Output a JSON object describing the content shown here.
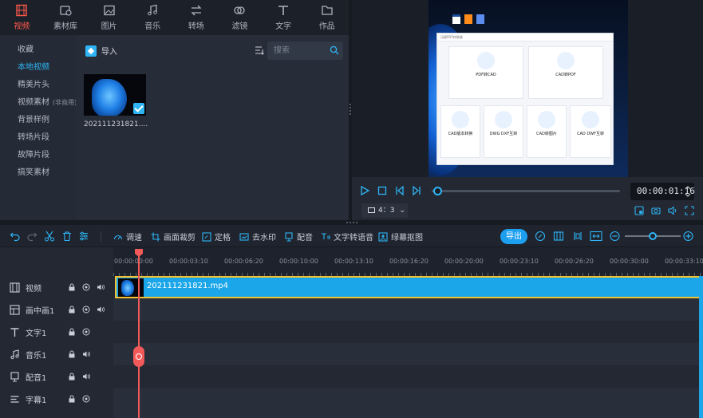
{
  "categories": [
    {
      "label": "视频",
      "icon": "film-icon",
      "active": true
    },
    {
      "label": "素材库",
      "icon": "media-library-icon"
    },
    {
      "label": "图片",
      "icon": "image-icon"
    },
    {
      "label": "音乐",
      "icon": "music-icon"
    },
    {
      "label": "转场",
      "icon": "transition-icon"
    },
    {
      "label": "滤镜",
      "icon": "filter-icon"
    },
    {
      "label": "文字",
      "icon": "text-icon"
    },
    {
      "label": "作品",
      "icon": "folder-icon"
    }
  ],
  "sidebar": {
    "items": [
      {
        "label": "收藏"
      },
      {
        "label": "本地视频",
        "active": true
      },
      {
        "label": "精美片头"
      },
      {
        "label": "视频素材",
        "sub": "(非商用)"
      },
      {
        "label": "背景样例"
      },
      {
        "label": "转场片段"
      },
      {
        "label": "故障片段"
      },
      {
        "label": "搞笑素材"
      }
    ]
  },
  "library": {
    "import_label": "导入",
    "search_placeholder": "搜索",
    "media": [
      {
        "name": "202111231821....",
        "selected": true
      }
    ]
  },
  "preview": {
    "window_title": "迅捷PDF转换器",
    "cards_row1": [
      {
        "title": "PDF转CAD"
      },
      {
        "title": "CAD转PDF"
      }
    ],
    "cards_row2": [
      {
        "title": "CAD版本转换"
      },
      {
        "title": "DWG DXF互转"
      },
      {
        "title": "CAD转图片"
      },
      {
        "title": "CAD DWF互转"
      }
    ],
    "timecode": "00:00:01:16",
    "aspect_ratio": "4：3",
    "progress": 0.03
  },
  "toolbar": {
    "tools": [
      {
        "label": "调速"
      },
      {
        "label": "画面裁剪"
      },
      {
        "label": "定格"
      },
      {
        "label": "去水印"
      },
      {
        "label": "配音"
      },
      {
        "label": "文字转语音"
      },
      {
        "label": "绿幕抠图"
      }
    ],
    "export_label": "导出",
    "zoom": 0.5
  },
  "ruler": {
    "ticks": [
      "00:00:00:00",
      "00:00:03:10",
      "00:00:06:20",
      "00:00:10:00",
      "00:00:13:10",
      "00:00:16:20",
      "00:00:20:00",
      "00:00:23:10",
      "00:00:26:20",
      "00:00:30:00",
      "00:00:33:10"
    ]
  },
  "tracks": [
    {
      "name": "视频",
      "icon": "video-track-icon",
      "controls": [
        "lock-icon",
        "eye-icon",
        "volume-icon"
      ]
    },
    {
      "name": "画中画1",
      "icon": "pip-track-icon",
      "controls": [
        "lock-icon",
        "eye-icon",
        "volume-icon"
      ]
    },
    {
      "name": "文字1",
      "icon": "text-track-icon",
      "controls": [
        "lock-icon",
        "eye-icon"
      ]
    },
    {
      "name": "音乐1",
      "icon": "music-track-icon",
      "controls": [
        "lock-icon",
        "volume-icon"
      ]
    },
    {
      "name": "配音1",
      "icon": "voiceover-track-icon",
      "controls": [
        "lock-icon",
        "volume-icon"
      ]
    },
    {
      "name": "字幕1",
      "icon": "subtitle-track-icon",
      "controls": [
        "lock-icon",
        "eye-icon"
      ]
    }
  ],
  "clip": {
    "name": "202111231821.mp4"
  }
}
